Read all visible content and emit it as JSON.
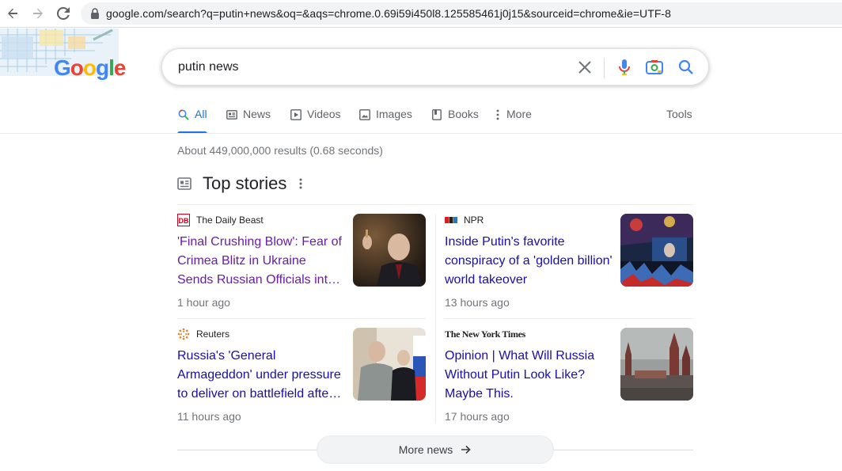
{
  "browser": {
    "url": "google.com/search?q=putin+news&oq=&aqs=chrome.0.69i59i450l8.125585461j0j15&sourceid=chrome&ie=UTF-8",
    "icons": [
      "back-arrow-icon",
      "forward-arrow-icon",
      "reload-icon",
      "lock-icon"
    ]
  },
  "logo": {
    "text": "Google"
  },
  "search": {
    "query": "putin news",
    "icons": [
      "clear-icon",
      "microphone-icon",
      "camera-icon",
      "search-icon"
    ]
  },
  "tabs": [
    {
      "label": "All",
      "icon": "search-icon",
      "active": true
    },
    {
      "label": "News",
      "icon": "newspaper-icon"
    },
    {
      "label": "Videos",
      "icon": "play-icon"
    },
    {
      "label": "Images",
      "icon": "image-icon"
    },
    {
      "label": "Books",
      "icon": "book-icon"
    },
    {
      "label": "More",
      "icon": "kebab-icon"
    }
  ],
  "tools_label": "Tools",
  "result_stats": "About 449,000,000 results (0.68 seconds)",
  "top_stories": {
    "title": "Top stories",
    "stories": [
      {
        "source": "The Daily Beast",
        "headline": "'Final Crushing Blow': Fear of Crimea Blitz in Ukraine Sends Russian Officials into Panic",
        "age": "1 hour ago",
        "visited": true
      },
      {
        "source": "NPR",
        "headline": "Inside Putin's favorite conspiracy of a 'golden billion' world takeover",
        "age": "13 hours ago",
        "visited": false
      },
      {
        "source": "Reuters",
        "headline": "Russia's 'General Armageddon' under pressure to deliver on battlefield after Kherson retreat",
        "age": "11 hours ago",
        "visited": false
      },
      {
        "source": "The New York Times",
        "headline": "Opinion | What Will Russia Without Putin Look Like? Maybe This.",
        "age": "17 hours ago",
        "visited": false
      }
    ]
  },
  "more_news_label": "More news",
  "colors": {
    "link": "#1a0dab",
    "visited": "#681da8",
    "accent": "#1a73e8"
  }
}
